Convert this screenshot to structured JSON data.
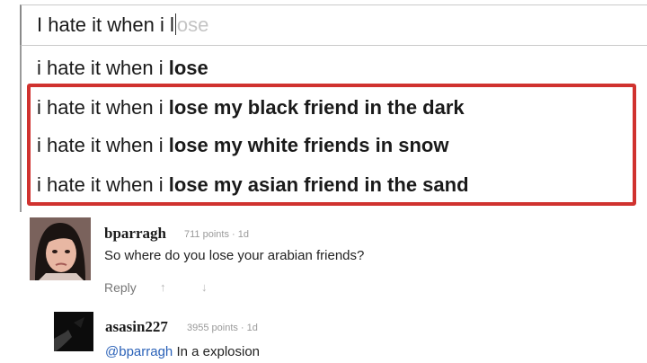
{
  "search": {
    "typed": "I hate it when i l",
    "ghost": "ose"
  },
  "suggestions": [
    {
      "typed": "i hate it when i ",
      "bold": "lose"
    },
    {
      "typed": "i hate it when i ",
      "bold": "lose my black friend in the dark"
    },
    {
      "typed": "i hate it when i ",
      "bold": "lose my white friends in snow"
    },
    {
      "typed": "i hate it when i ",
      "bold": "lose my asian friend in the sand"
    }
  ],
  "colors": {
    "highlight": "#d0322f",
    "mention": "#2b62b8"
  },
  "comments": [
    {
      "author": "bparragh",
      "meta": "711 points · 1d",
      "text": "So where do you lose your arabian friends?",
      "reply_label": "Reply",
      "upvote_icon": "↑",
      "downvote_icon": "↓"
    },
    {
      "author": "asasin227",
      "meta": "3955 points · 1d",
      "mention": "@bparragh",
      "text": " In a explosion"
    }
  ]
}
